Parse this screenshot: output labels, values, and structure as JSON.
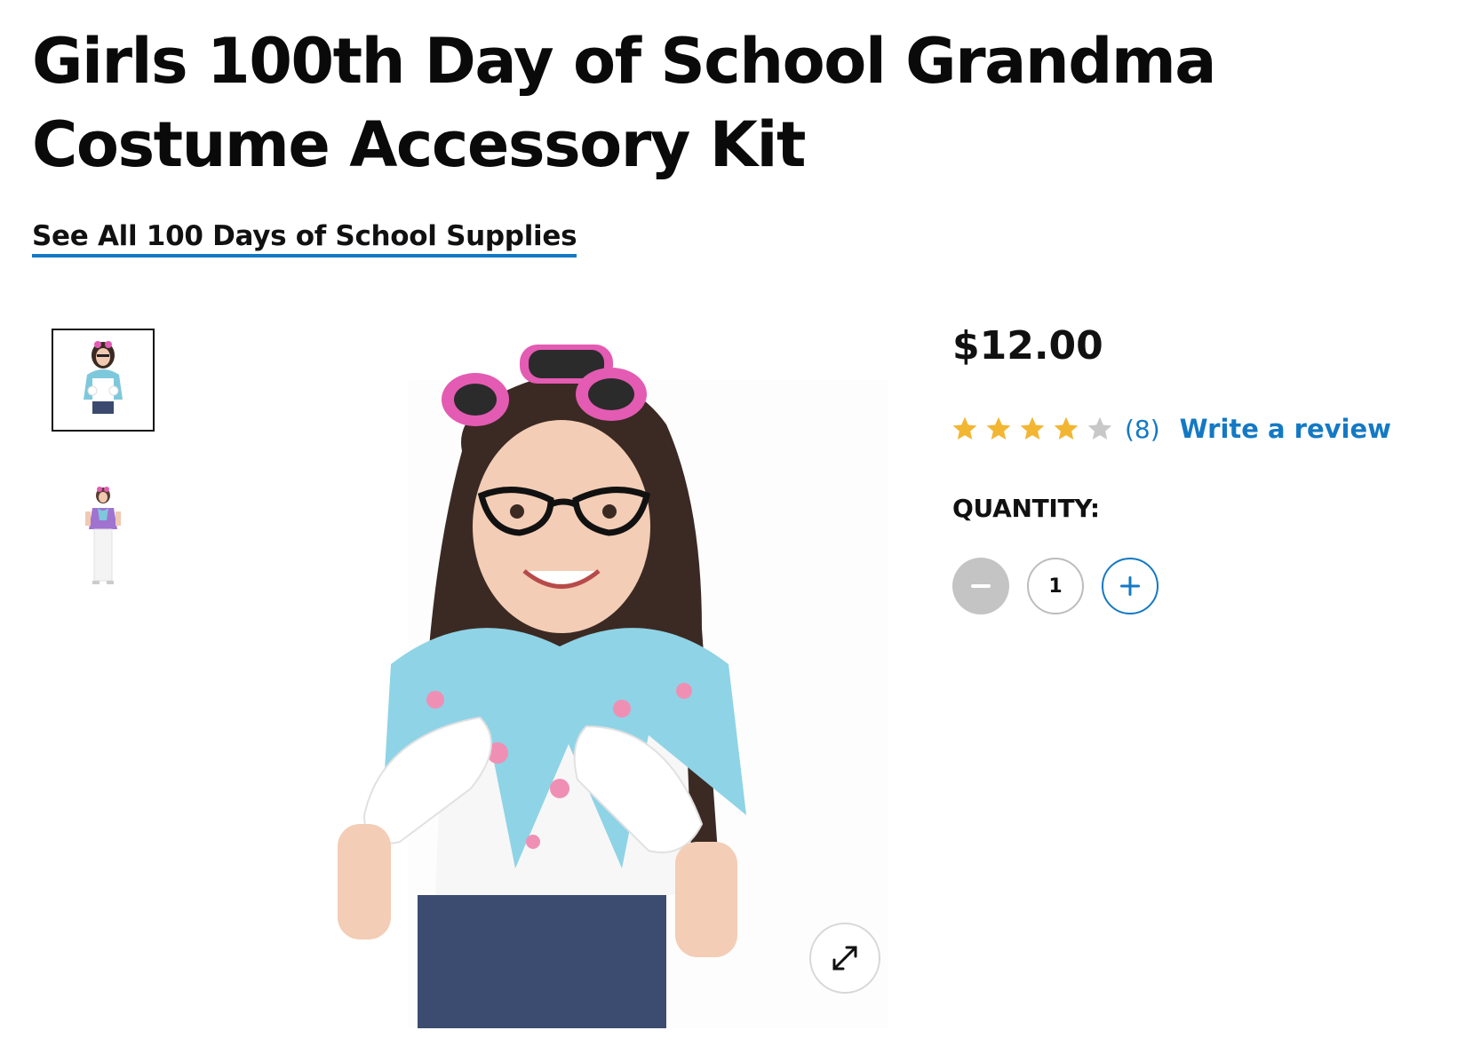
{
  "product": {
    "title": "Girls 100th Day of School Grandma Costume Accessory Kit",
    "see_all_link": "See All 100 Days of School Supplies",
    "price": "$12.00",
    "rating": {
      "value": 4,
      "max": 5,
      "count_label": "(8)"
    },
    "write_review_label": "Write a review",
    "quantity_label": "QUANTITY:",
    "quantity_value": "1"
  },
  "gallery": {
    "thumbnails": [
      {
        "name": "thumbnail-1",
        "active": true
      },
      {
        "name": "thumbnail-2",
        "active": false
      }
    ],
    "expand_icon": "expand-icon"
  },
  "colors": {
    "link_blue": "#1479c4",
    "star_gold": "#f2b632",
    "star_empty": "#c8c8c8",
    "minus_disabled": "#c4c4c4"
  }
}
